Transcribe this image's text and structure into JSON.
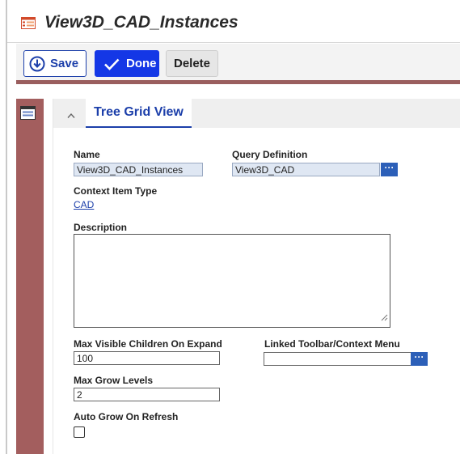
{
  "window": {
    "title": "View3D_CAD_Instances"
  },
  "toolbar": {
    "save_label": "Save",
    "done_label": "Done",
    "delete_label": "Delete"
  },
  "tab": {
    "label": "Tree Grid View"
  },
  "form": {
    "name_label": "Name",
    "name_value": "View3D_CAD_Instances",
    "query_label": "Query Definition",
    "query_value": "View3D_CAD",
    "context_label": "Context Item Type",
    "context_value": "CAD",
    "description_label": "Description",
    "description_value": "",
    "max_visible_label": "Max Visible Children On Expand",
    "max_visible_value": "100",
    "linked_toolbar_label": "Linked Toolbar/Context Menu",
    "linked_toolbar_value": "",
    "max_grow_label": "Max Grow Levels",
    "max_grow_value": "2",
    "auto_grow_label": "Auto Grow On Refresh",
    "auto_grow_checked": false
  },
  "icons": {
    "title": "grid-form-icon",
    "save": "save-circle-arrow-icon",
    "done": "checkmark-icon",
    "sidebar": "form-view-icon",
    "tab_toggle": "chevron-up-icon",
    "lookup": "ellipsis-icon",
    "resize": "resize-grip-icon"
  },
  "colors": {
    "accent": "#1c3faa",
    "done_bg": "#1437e6",
    "sidebar": "#a35e5e",
    "field_bg": "#dfe7f3",
    "lookup_bg": "#2c5fb8"
  }
}
